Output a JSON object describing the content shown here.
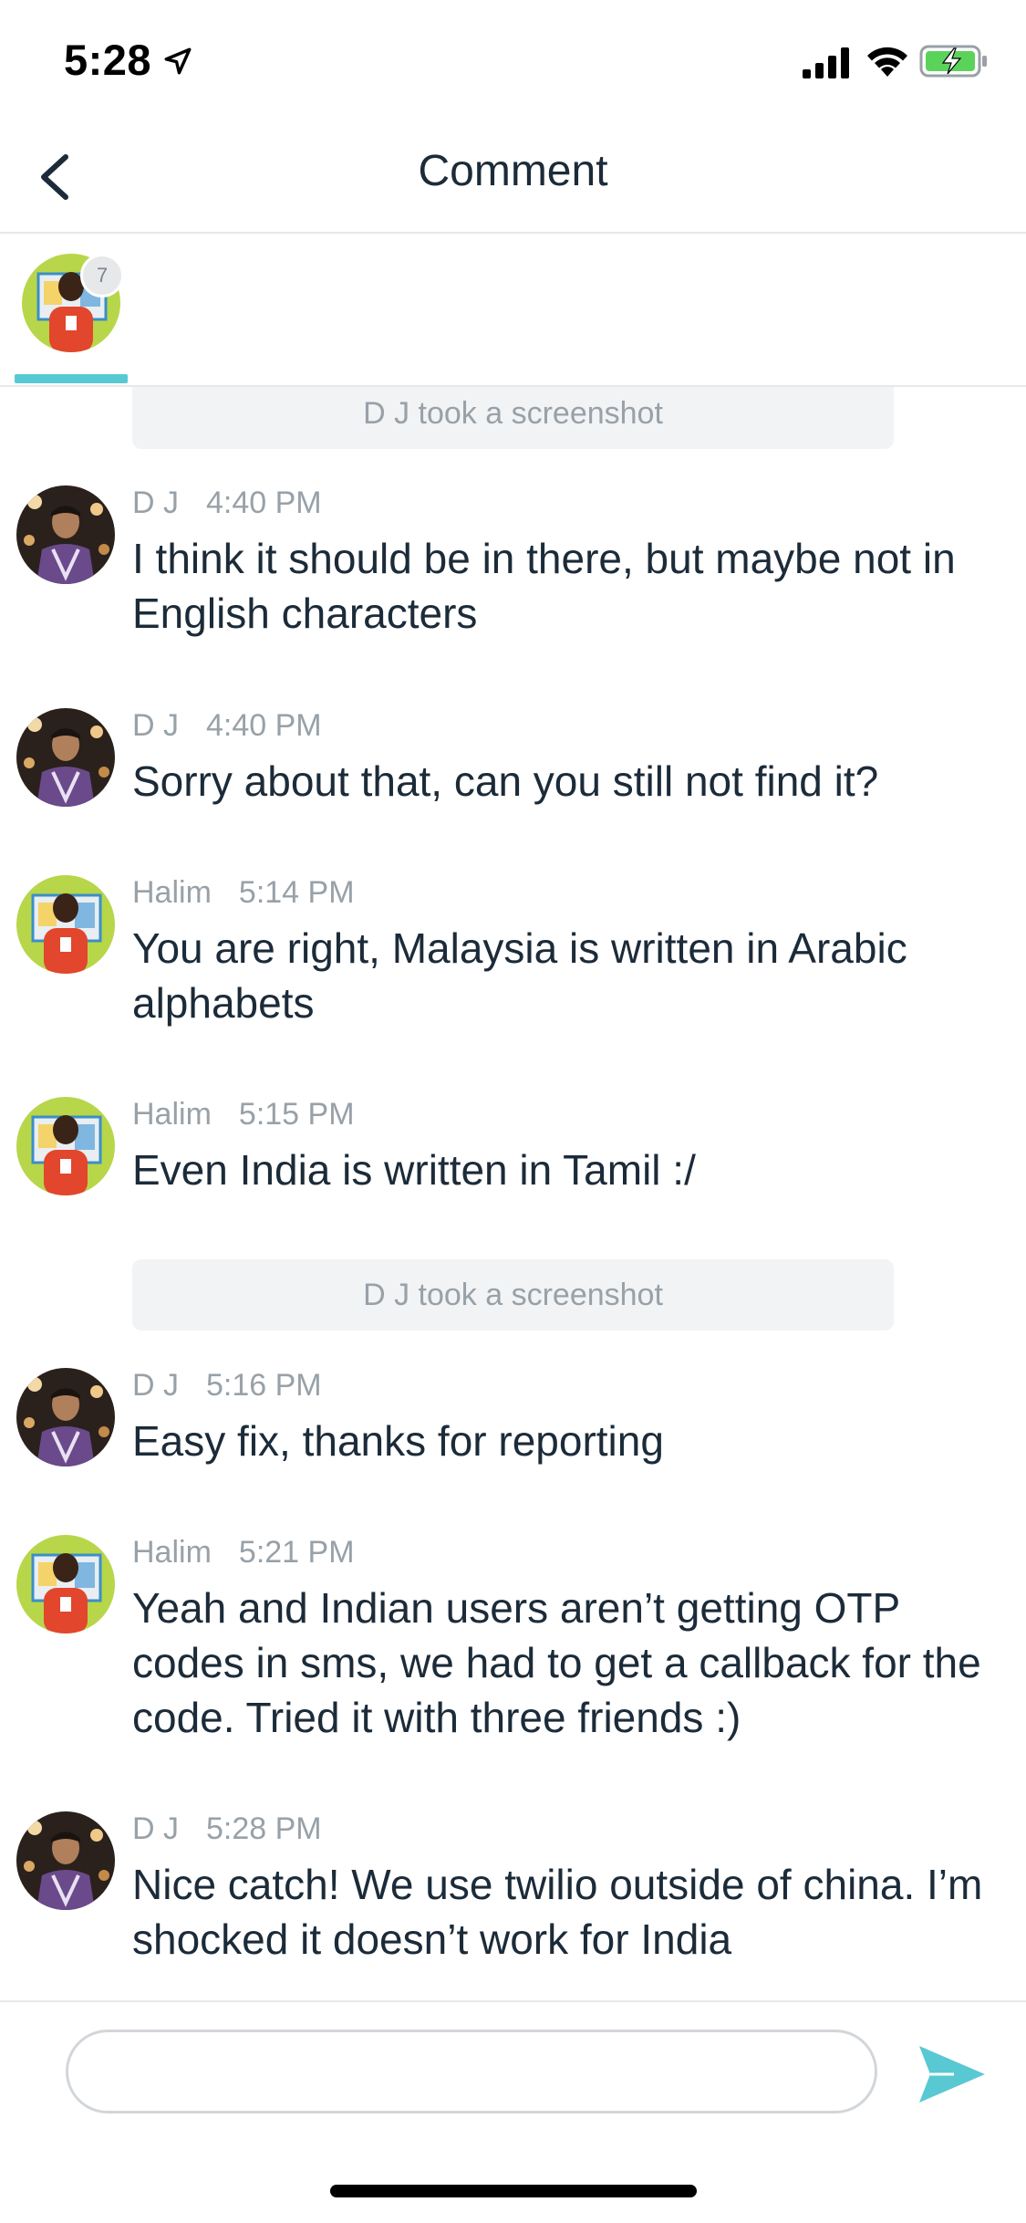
{
  "status_bar": {
    "time": "5:28"
  },
  "nav": {
    "title": "Comment"
  },
  "participant": {
    "badge_count": "7"
  },
  "messages": [
    {
      "type": "system",
      "text": "D J took a screenshot"
    },
    {
      "type": "message",
      "sender": "D J",
      "time": "4:40 PM",
      "text": "I think it should be in there, but maybe not in English characters",
      "avatar": "dj"
    },
    {
      "type": "message",
      "sender": "D J",
      "time": "4:40 PM",
      "text": "Sorry about that, can you still not find it?",
      "avatar": "dj"
    },
    {
      "type": "message",
      "sender": "Halim",
      "time": "5:14 PM",
      "text": "You are right, Malaysia is written in Arabic alphabets",
      "avatar": "halim"
    },
    {
      "type": "message",
      "sender": "Halim",
      "time": "5:15 PM",
      "text": "Even India is written in Tamil :/",
      "avatar": "halim"
    },
    {
      "type": "system",
      "text": "D J took a screenshot"
    },
    {
      "type": "message",
      "sender": "D J",
      "time": "5:16 PM",
      "text": "Easy fix, thanks for reporting",
      "avatar": "dj"
    },
    {
      "type": "message",
      "sender": "Halim",
      "time": "5:21 PM",
      "text": "Yeah and Indian users aren’t getting OTP codes in sms, we had to get a callback for the code. Tried it with three friends :)",
      "avatar": "halim"
    },
    {
      "type": "message",
      "sender": "D J",
      "time": "5:28 PM",
      "text": "Nice catch!  We use twilio outside of china. I’m shocked it doesn’t work for India",
      "avatar": "dj"
    }
  ],
  "composer": {
    "value": ""
  },
  "icons": {
    "back": "chevron-left-icon",
    "send": "paper-plane-send-icon",
    "location": "location-arrow-icon",
    "signal": "cellular-signal-icon",
    "wifi": "wifi-icon",
    "battery": "battery-charging-icon"
  },
  "colors": {
    "accent": "#58c9d2",
    "text": "#1c2b39",
    "meta": "#98a1a8",
    "system_bg": "#f2f3f5",
    "battery_green": "#5bd35b"
  }
}
